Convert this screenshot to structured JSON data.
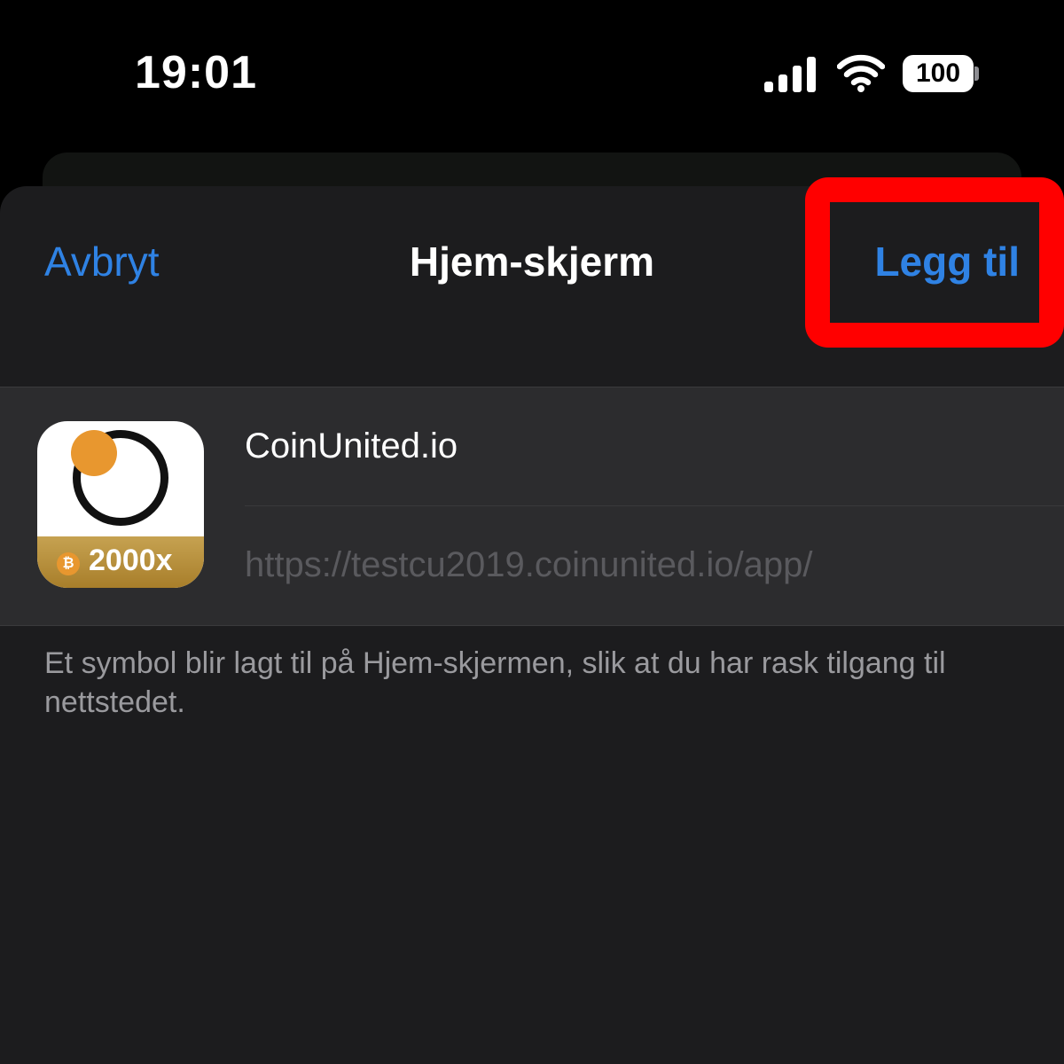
{
  "status_bar": {
    "time": "19:01",
    "battery": "100",
    "icons": [
      "signal-icon",
      "wifi-icon",
      "battery-icon"
    ]
  },
  "nav": {
    "cancel_label": "Avbryt",
    "title": "Hjem-skjerm",
    "add_label": "Legg til"
  },
  "app_entry": {
    "name": "CoinUnited.io",
    "url": "https://testcu2019.coinunited.io/app/",
    "icon_badge": "2000x",
    "icon_coin_symbol": "₿"
  },
  "footer_note": "Et symbol blir lagt til på Hjem-skjermen, slik at du har rask tilgang til nettstedet.",
  "colors": {
    "accent": "#2f82e4",
    "highlight": "#ff0000",
    "sheet_background": "#1c1c1e",
    "card_background": "#2c2c2e",
    "icon_orange": "#e8972f",
    "icon_gold": "#b8923e"
  }
}
